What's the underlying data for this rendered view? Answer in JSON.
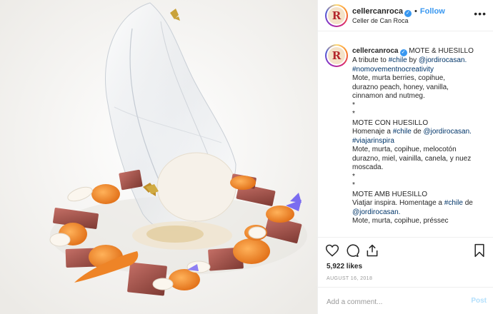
{
  "header": {
    "username": "cellercanroca",
    "verified_badge": "✓",
    "separator": "•",
    "follow_label": "Follow",
    "location": "Celler de Can Roca",
    "avatar_letter": "R",
    "more_icon": "•••"
  },
  "caption": {
    "avatar_letter": "R",
    "username": "cellercanroca",
    "lines": [
      "MOTE & HUESILLO",
      "A tribute to ",
      "#nomovementnocreativity",
      "Mote, murta berries, copihue,",
      "durazno peach, honey, vanilla,",
      "cinnamon and nutmeg.",
      "*",
      "*",
      "MOTE CON HUESILLO",
      "Homenaje a ",
      "#viajarinspira",
      "Mote, murta, copihue, melocotón",
      "durazno, miel, vainilla, canela, y nuez",
      "moscada.",
      "*",
      "*",
      "MOTE AMB HUESILLO",
      "Viatjar inspira. Homentage a ",
      "@jordirocasan.",
      "Mote, murta, copihue, préssec"
    ],
    "tag_chile": "#chile",
    "by": " by ",
    "mention": "@jordirocasan.",
    "de": " de ",
    "period": "."
  },
  "actions": {
    "likes": "5,922 likes",
    "date": "AUGUST 16, 2018"
  },
  "comment": {
    "placeholder": "Add a comment...",
    "post_label": "Post"
  },
  "colors": {
    "link": "#003569",
    "follow": "#3897f0",
    "post_disabled": "#b2dffc"
  }
}
